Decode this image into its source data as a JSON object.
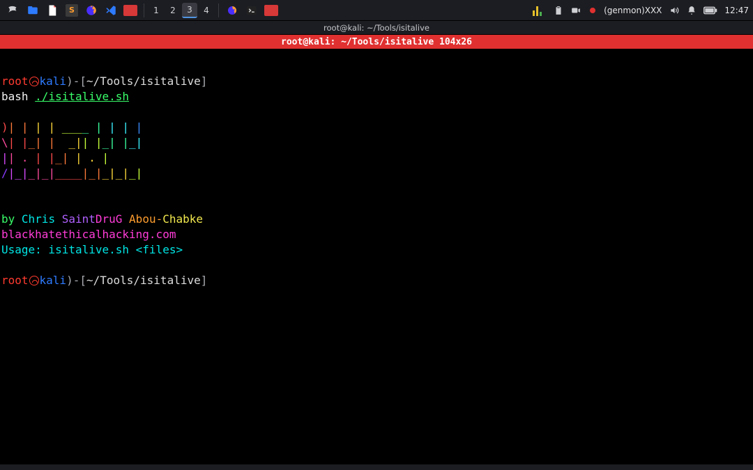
{
  "taskbar": {
    "workspaces": [
      "1",
      "2",
      "3",
      "4"
    ],
    "active_workspace": 2,
    "tray": {
      "genmon": "(genmon)XXX",
      "clock": "12:47"
    }
  },
  "window": {
    "title": "root@kali: ~/Tools/isitalive"
  },
  "tmux": {
    "status": "root@kali: ~/Tools/isitalive 104x26"
  },
  "prompt1": {
    "user": "root",
    "host": "kali",
    "cwd": "~/Tools/isitalive",
    "cmd_pre": "bash ",
    "cmd_file": "./isitalive.sh"
  },
  "ascii": {
    "r1": [
      ")",
      "| |",
      " | |",
      " ___",
      "_ |",
      " | |",
      " |"
    ],
    "r2": [
      "\\",
      "| |",
      "_| |",
      "  _|",
      "| |",
      "_| |",
      "_|"
    ],
    "r3": [
      "|",
      "| .",
      " | |",
      "_| ",
      "| .",
      " |  ",
      " "
    ],
    "r4": [
      "/",
      "|_|",
      "_|_|",
      "____",
      "|_|",
      "_|_|",
      "_|"
    ],
    "r5": [
      " ",
      "   ",
      "    ",
      "    ",
      "   ",
      "    ",
      " "
    ]
  },
  "credits": {
    "ln1a": "by ",
    "ln1b": "Chris ",
    "ln1c": "Saint",
    "ln1d": "DruG ",
    "ln1e": "Abou-",
    "ln1f": "Chabke",
    "url": "blackhatethicalhacking.com",
    "usage": "Usage: isitalive.sh <files>"
  },
  "prompt2": {
    "user": "root",
    "host": "kali",
    "cwd": "~/Tools/isitalive"
  }
}
